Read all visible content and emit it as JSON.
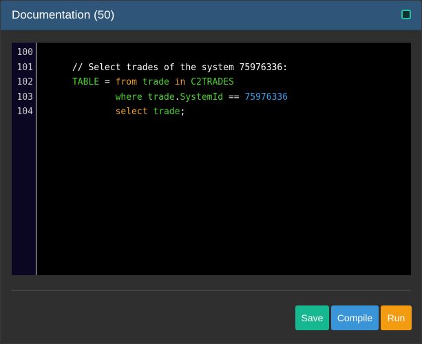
{
  "dialog": {
    "title": "Documentation (50)",
    "restore_icon": "restore-window-icon"
  },
  "editor": {
    "line_numbers": [
      "100",
      "101",
      "102",
      "103",
      "104"
    ],
    "lines": [
      [
        {
          "text": "// Select trades of the system 75976336:",
          "kind": "comment"
        }
      ],
      [
        {
          "text": "TABLE",
          "kind": "ident"
        },
        {
          "text": " = ",
          "kind": "op"
        },
        {
          "text": "from",
          "kind": "kw-orange"
        },
        {
          "text": " trade ",
          "kind": "ident"
        },
        {
          "text": "in",
          "kind": "kw-orange"
        },
        {
          "text": " C2TRADES",
          "kind": "ident"
        }
      ],
      [
        {
          "text": "        where",
          "kind": "kw-green"
        },
        {
          "text": " trade",
          "kind": "ident"
        },
        {
          "text": ".",
          "kind": "op"
        },
        {
          "text": "SystemId",
          "kind": "ident"
        },
        {
          "text": " == ",
          "kind": "op"
        },
        {
          "text": "75976336",
          "kind": "num"
        }
      ],
      [
        {
          "text": "        select",
          "kind": "kw-orange"
        },
        {
          "text": " trade",
          "kind": "ident"
        },
        {
          "text": ";",
          "kind": "punct"
        }
      ],
      []
    ]
  },
  "footer": {
    "save_label": "Save",
    "compile_label": "Compile",
    "run_label": "Run"
  },
  "colors": {
    "titlebar": "#2f5578",
    "save": "#15b890",
    "compile": "#3a94d8",
    "run": "#f39c12",
    "keyword_green": "#49d12d",
    "keyword_orange": "#f0a02a",
    "number": "#3aa0ef"
  }
}
